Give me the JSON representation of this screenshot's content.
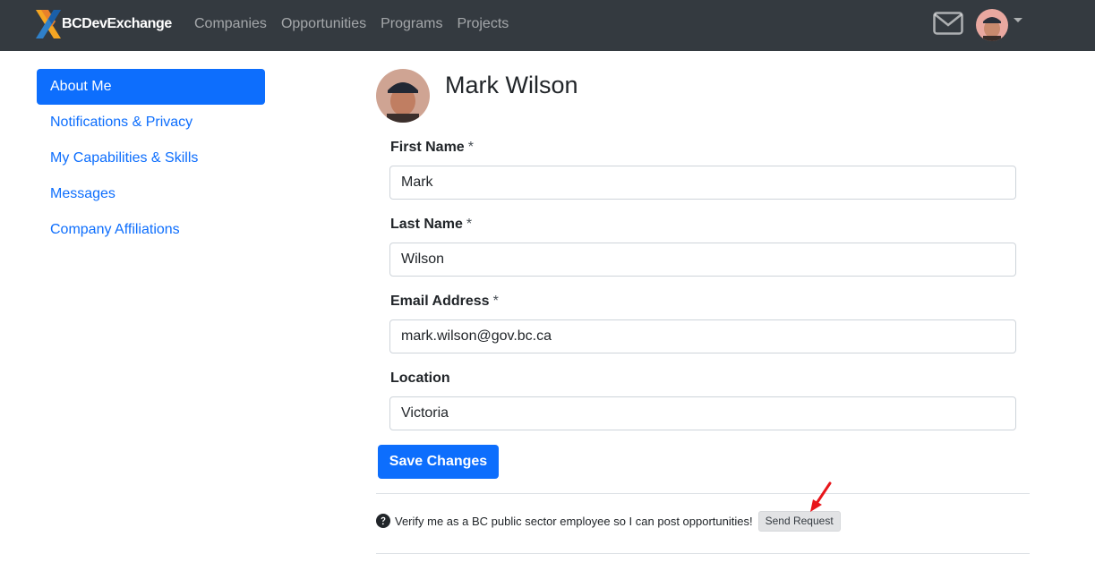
{
  "navbar": {
    "brand": "BCDevExchange",
    "links": [
      "Companies",
      "Opportunities",
      "Programs",
      "Projects"
    ],
    "mail_icon": "envelope-icon",
    "avatar_icon": "user-avatar"
  },
  "sidebar": {
    "items": [
      {
        "label": "About Me",
        "active": true
      },
      {
        "label": "Notifications & Privacy",
        "active": false
      },
      {
        "label": "My Capabilities & Skills",
        "active": false
      },
      {
        "label": "Messages",
        "active": false
      },
      {
        "label": "Company Affiliations",
        "active": false
      }
    ]
  },
  "profile": {
    "name": "Mark Wilson"
  },
  "form": {
    "first_name": {
      "label": "First Name",
      "required": "*",
      "value": "Mark"
    },
    "last_name": {
      "label": "Last Name",
      "required": "*",
      "value": "Wilson"
    },
    "email": {
      "label": "Email Address",
      "required": "*",
      "value": "mark.wilson@gov.bc.ca"
    },
    "location": {
      "label": "Location",
      "value": "Victoria"
    },
    "save_label": "Save Changes"
  },
  "verify": {
    "text": "Verify me as a BC public sector employee so I can post opportunities!",
    "button_label": "Send Request"
  },
  "colors": {
    "navbar_bg": "#343a40",
    "primary": "#0d6efd",
    "annotation_arrow": "#e8161b"
  }
}
